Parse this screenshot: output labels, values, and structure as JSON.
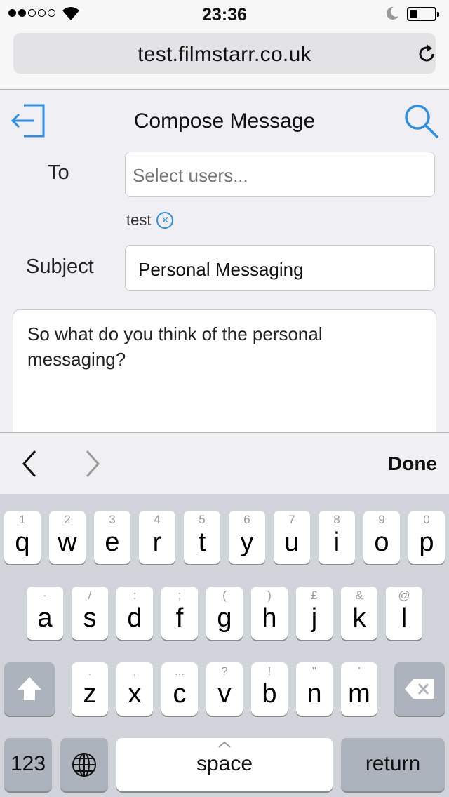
{
  "status": {
    "time": "23:36"
  },
  "browser": {
    "url": "test.filmstarr.co.uk"
  },
  "header": {
    "title": "Compose Message"
  },
  "form": {
    "to_label": "To",
    "to_placeholder": "Select users...",
    "recipient_chip": "test",
    "chip_remove": "⊗",
    "subject_label": "Subject",
    "subject_value": "Personal Messaging",
    "body_value": "So what do you think of the personal messaging?"
  },
  "accessory": {
    "done_label": "Done"
  },
  "keyboard": {
    "row1": [
      {
        "alt": "1",
        "key": "q"
      },
      {
        "alt": "2",
        "key": "w"
      },
      {
        "alt": "3",
        "key": "e"
      },
      {
        "alt": "4",
        "key": "r"
      },
      {
        "alt": "5",
        "key": "t"
      },
      {
        "alt": "6",
        "key": "y"
      },
      {
        "alt": "7",
        "key": "u"
      },
      {
        "alt": "8",
        "key": "i"
      },
      {
        "alt": "9",
        "key": "o"
      },
      {
        "alt": "0",
        "key": "p"
      }
    ],
    "row2": [
      {
        "alt": "-",
        "key": "a"
      },
      {
        "alt": "/",
        "key": "s"
      },
      {
        "alt": ":",
        "key": "d"
      },
      {
        "alt": ";",
        "key": "f"
      },
      {
        "alt": "(",
        "key": "g"
      },
      {
        "alt": ")",
        "key": "h"
      },
      {
        "alt": "£",
        "key": "j"
      },
      {
        "alt": "&",
        "key": "k"
      },
      {
        "alt": "@",
        "key": "l"
      }
    ],
    "row3": [
      {
        "alt": ".",
        "key": "z"
      },
      {
        "alt": ",",
        "key": "x"
      },
      {
        "alt": "...",
        "key": "c"
      },
      {
        "alt": "?",
        "key": "v"
      },
      {
        "alt": "!",
        "key": "b"
      },
      {
        "alt": "\"",
        "key": "n"
      },
      {
        "alt": "'",
        "key": "m"
      }
    ],
    "numbers_label": "123",
    "space_label": "space",
    "return_label": "return"
  },
  "icons": {
    "back": "logout-arrow-icon",
    "search": "search-icon",
    "reload": "reload-icon",
    "shift": "shift-icon",
    "backspace": "backspace-icon",
    "globe": "globe-icon"
  },
  "colors": {
    "accent": "#2d8ee6"
  }
}
